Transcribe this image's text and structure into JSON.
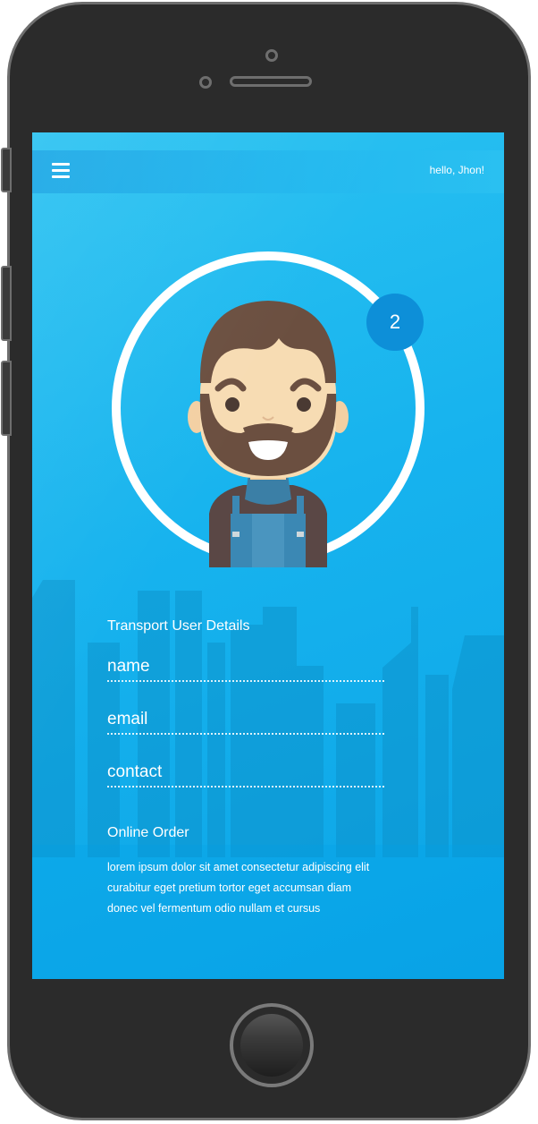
{
  "header": {
    "greeting": "hello, Jhon!",
    "menu_icon": "hamburger-menu-icon"
  },
  "profile": {
    "notification_count": "2",
    "avatar_icon": "bearded-man-avatar"
  },
  "details": {
    "title": "Transport User Details",
    "fields": [
      {
        "label": "name"
      },
      {
        "label": "email"
      },
      {
        "label": "contact"
      }
    ]
  },
  "order": {
    "title": "Online Order",
    "lines": [
      "lorem ipsum dolor sit amet consectetur adipiscing elit",
      "curabitur eget pretium tortor eget accumsan diam",
      "donec vel fermentum odio nullam et cursus"
    ]
  },
  "colors": {
    "screen_top": "#2cc3f1",
    "screen_bottom": "#0ba4e6",
    "badge": "#0d8fd8",
    "text": "#ffffff"
  }
}
